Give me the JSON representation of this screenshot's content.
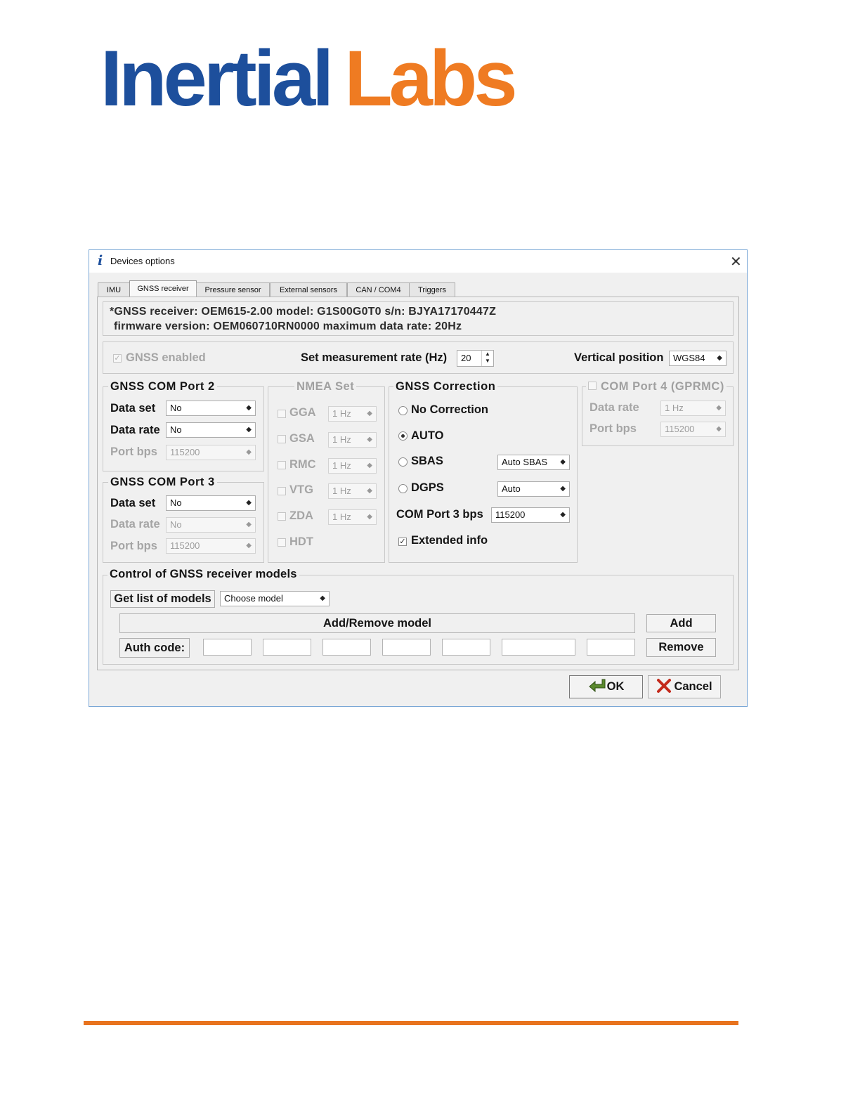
{
  "logo": {
    "word1": "Inertial",
    "word2": "Labs"
  },
  "colors": {
    "logo_blue": "#1d4f9c",
    "logo_orange": "#ef7b22",
    "footer_rule": "#e8731e",
    "window_border": "#7aa7d6"
  },
  "dialog": {
    "title_icon": "i",
    "title": "Devices options",
    "close_glyph": "✕",
    "tabs": [
      {
        "label": "IMU",
        "active": false
      },
      {
        "label": "GNSS receiver",
        "active": true
      },
      {
        "label": "Pressure sensor",
        "active": false
      },
      {
        "label": "External sensors",
        "active": false
      },
      {
        "label": "CAN / COM4",
        "active": false
      },
      {
        "label": "Triggers",
        "active": false
      }
    ],
    "info_line1": "*GNSS receiver: OEM615-2.00 model: G1S00G0T0 s/n: BJYA17170447Z",
    "info_line2": "firmware version: OEM060710RN0000 maximum data rate: 20Hz",
    "gnss_enabled": {
      "label": "GNSS enabled",
      "checked": true,
      "disabled": true
    },
    "measurement_rate": {
      "label": "Set measurement rate (Hz)",
      "value": "20"
    },
    "vertical_position": {
      "label": "Vertical position",
      "value": "WGS84"
    },
    "com_port2": {
      "title": "GNSS COM Port 2",
      "data_set_label": "Data set",
      "data_set_value": "No",
      "data_rate_label": "Data rate",
      "data_rate_value": "No",
      "port_bps_label": "Port bps",
      "port_bps_value": "115200"
    },
    "com_port3": {
      "title": "GNSS COM Port 3",
      "data_set_label": "Data set",
      "data_set_value": "No",
      "data_rate_label": "Data rate",
      "data_rate_value": "No",
      "port_bps_label": "Port bps",
      "port_bps_value": "115200"
    },
    "nmea_set": {
      "title": "NMEA Set",
      "items": [
        {
          "label": "GGA",
          "rate": "1 Hz"
        },
        {
          "label": "GSA",
          "rate": "1 Hz"
        },
        {
          "label": "RMC",
          "rate": "1 Hz"
        },
        {
          "label": "VTG",
          "rate": "1 Hz"
        },
        {
          "label": "ZDA",
          "rate": "1 Hz"
        },
        {
          "label": "HDT",
          "rate": ""
        }
      ]
    },
    "gnss_correction": {
      "title": "GNSS Correction",
      "no_correction": "No Correction",
      "auto": "AUTO",
      "sbas": "SBAS",
      "sbas_value": "Auto SBAS",
      "dgps": "DGPS",
      "dgps_value": "Auto",
      "selected": "AUTO",
      "com3_bps_label": "COM Port 3 bps",
      "com3_bps_value": "115200",
      "extended_info_label": "Extended info",
      "extended_info_checked": true
    },
    "com_port4": {
      "title": "COM Port 4 (GPRMC)",
      "checked": false,
      "data_rate_label": "Data rate",
      "data_rate_value": "1 Hz",
      "port_bps_label": "Port bps",
      "port_bps_value": "115200"
    },
    "models": {
      "title": "Control of GNSS receiver models",
      "get_list_label": "Get list of models",
      "choose_model": "Choose model",
      "add_remove_label": "Add/Remove model",
      "auth_code_label": "Auth code:",
      "add_label": "Add",
      "remove_label": "Remove"
    },
    "ok_label": "OK",
    "cancel_label": "Cancel"
  }
}
